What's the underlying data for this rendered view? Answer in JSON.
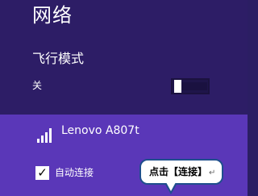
{
  "panel": {
    "title": "网络"
  },
  "airplane_mode": {
    "label": "飞行模式",
    "state_text": "关",
    "is_on": false
  },
  "network": {
    "name": "Lenovo A807t",
    "signal_icon": "wifi-signal-icon"
  },
  "auto_connect": {
    "checked": true,
    "label": "自动连接"
  },
  "callout": {
    "text": "点击【连接】",
    "mark": "↵"
  },
  "colors": {
    "top_background": "#2d1d66",
    "bottom_background": "#5a37b8",
    "callout_border": "#1f4f8d"
  }
}
